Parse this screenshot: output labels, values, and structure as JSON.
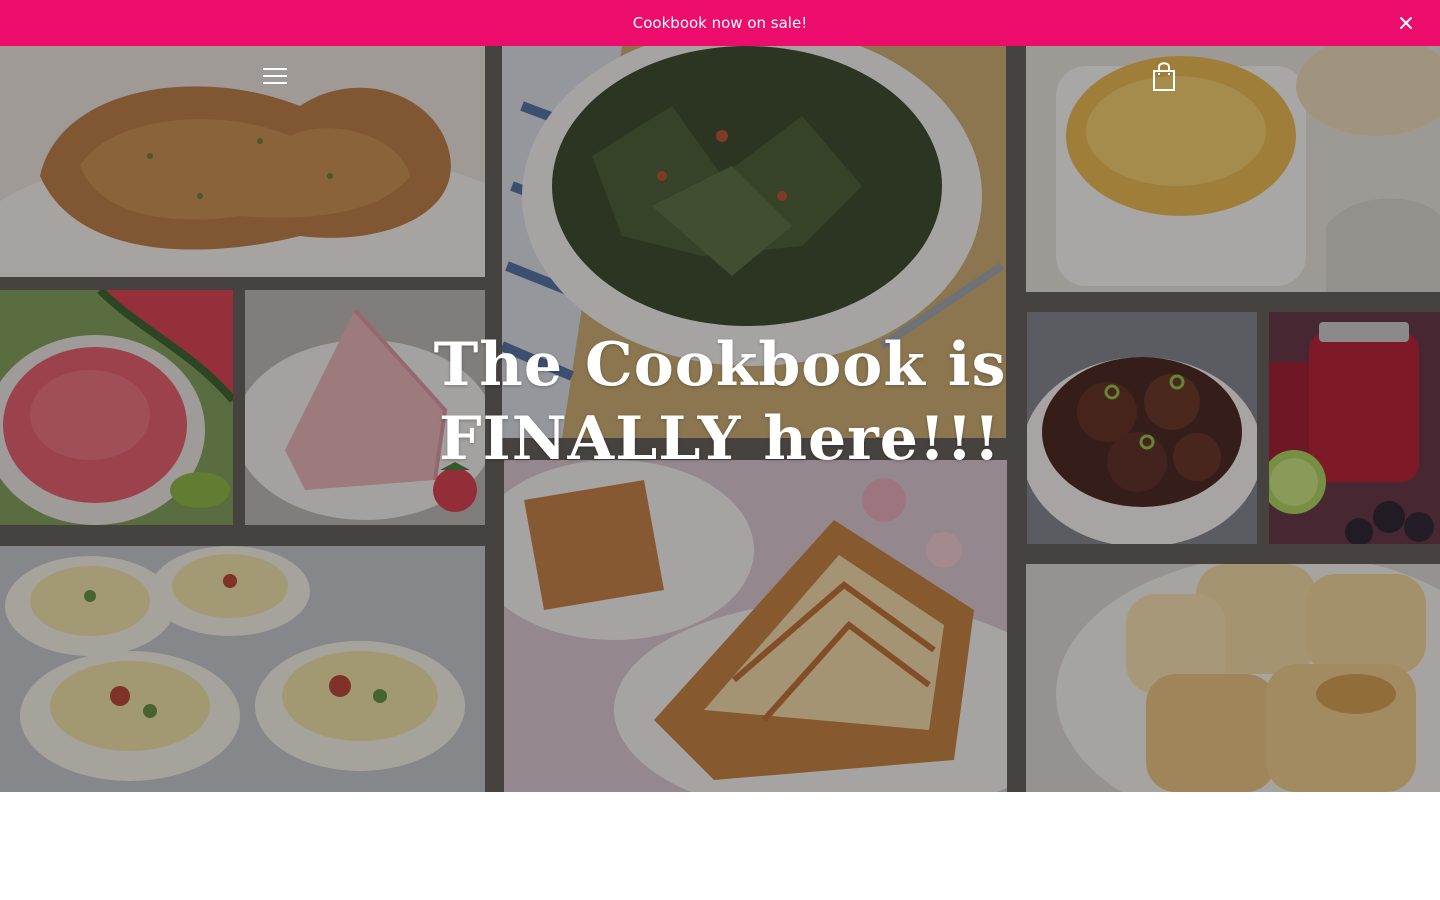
{
  "announcement": {
    "text": "Cookbook now on sale!",
    "background": "#ec0c6c",
    "text_color": "#ffffff",
    "close_icon": "close-icon"
  },
  "header": {
    "menu_icon": "hamburger-menu-icon",
    "cart_icon": "shopping-bag-icon"
  },
  "hero": {
    "title": "The Cookbook is FINALLY here!!!",
    "collage_tiles": [
      "fried-chicken-image",
      "collard-greens-image",
      "mac-and-cheese-image",
      "watermelon-smoothie-image",
      "strawberry-cake-slice-image",
      "meatballs-image",
      "jam-jar-image",
      "deviled-eggs-image",
      "caramel-layer-cake-image",
      "dinner-rolls-image"
    ]
  }
}
